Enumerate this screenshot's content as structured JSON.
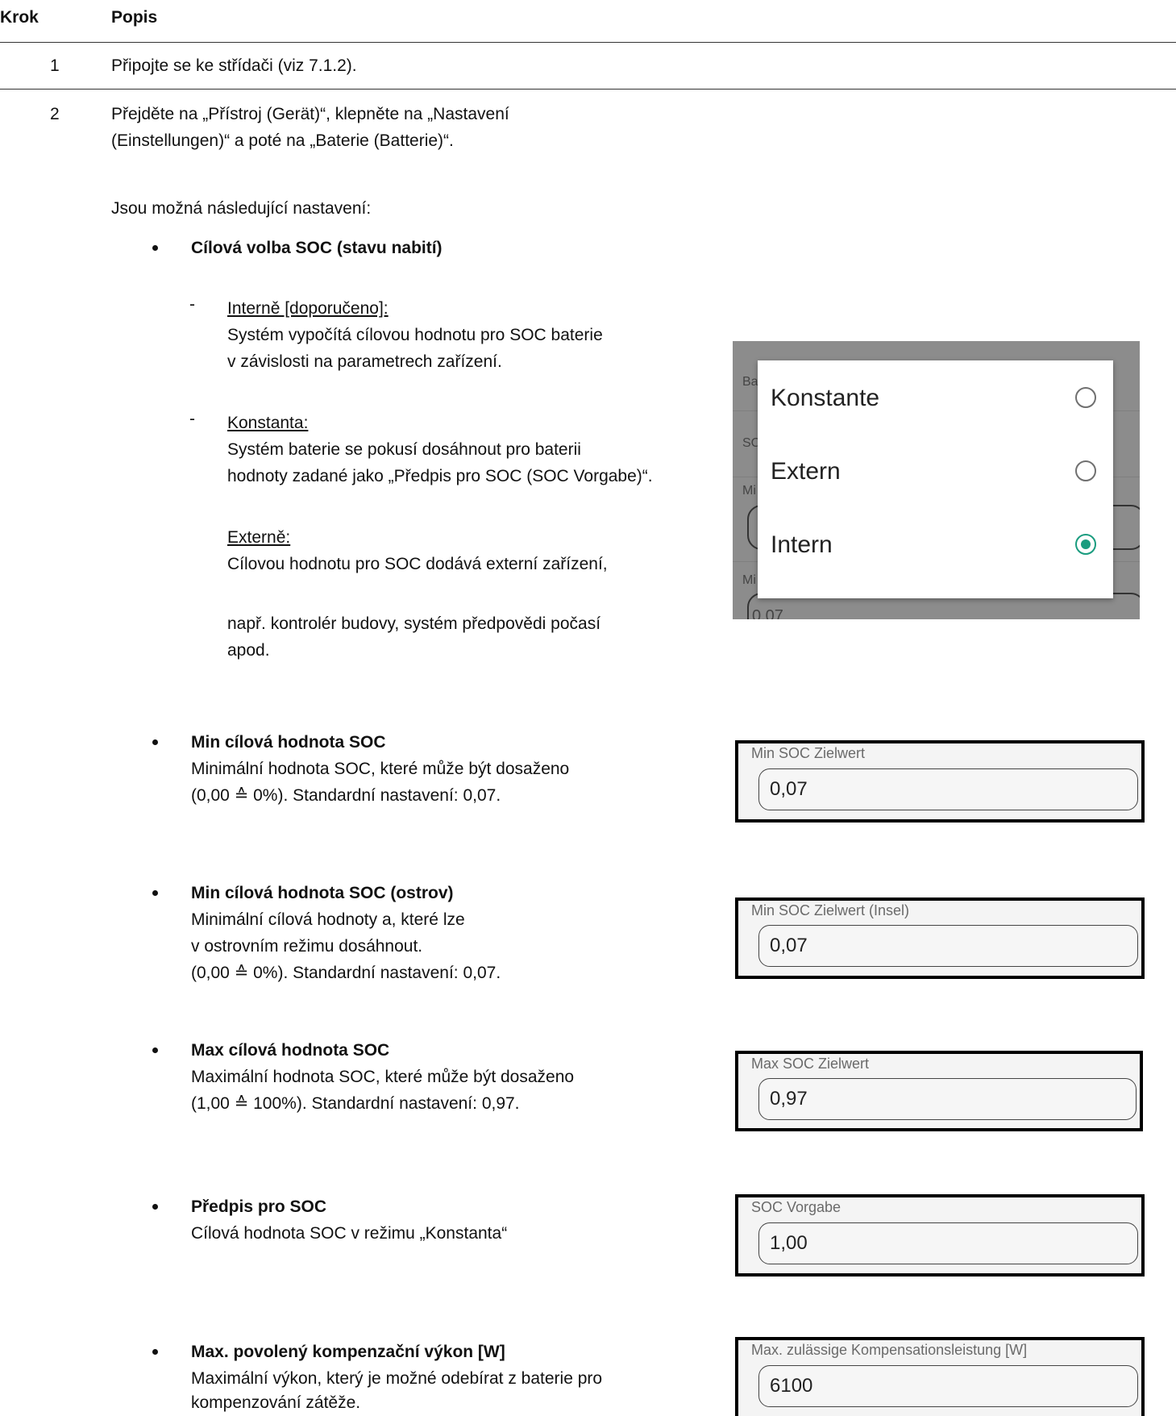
{
  "table": {
    "headers": {
      "step": "Krok",
      "description": "Popis"
    },
    "row1": {
      "step": "1",
      "text": "Připojte se ke střídači (viz 7.1.2)."
    },
    "row2": {
      "step": "2",
      "line1": "Přejděte na „Přístroj (Gerät)“, klepněte na „Nastavení",
      "line2": "(Einstellungen)“ a poté na „Baterie (Batterie)“.",
      "intro": "Jsou možná následující nastavení:"
    }
  },
  "soc_target": {
    "title": "Cílová volba SOC (stavu nabití)",
    "intern": {
      "label": "Interně [doporučeno]:",
      "line1": "Systém vypočítá cílovou hodnotu pro SOC baterie",
      "line2": "v závislosti na parametrech zařízení."
    },
    "konst": {
      "label": "Konstanta:",
      "line1": "Systém baterie se pokusí dosáhnout pro baterii",
      "line2": "hodnoty zadané jako „Předpis pro SOC (SOC Vorgabe)“."
    },
    "extern": {
      "label": "Externě:",
      "line1": "Cílovou hodnotu pro SOC dodává externí zařízení,",
      "line2": "např. kontrolér budovy, systém předpovědi počasí",
      "line3": "apod."
    }
  },
  "dialog": {
    "options": [
      {
        "label": "Konstante",
        "selected": false
      },
      {
        "label": "Extern",
        "selected": false
      },
      {
        "label": "Intern",
        "selected": true
      }
    ],
    "background_fragments": [
      "Ba",
      "SC",
      "Mi",
      "Mi",
      "0,07"
    ],
    "accent_color": "#1a9c7f"
  },
  "min_soc": {
    "title": "Min cílová hodnota SOC",
    "line1": "Minimální hodnota SOC, které může být dosaženo",
    "line2": "(0,00 ≙ 0%). Standardní nastavení: 0,07."
  },
  "min_soc_island": {
    "title": "Min cílová hodnota SOC (ostrov)",
    "line1": "Minimální cílová hodnoty a, které lze",
    "line2": "v ostrovním režimu dosáhnout.",
    "line3": "(0,00 ≙ 0%). Standardní nastavení: 0,07."
  },
  "max_soc": {
    "title": "Max cílová hodnota SOC",
    "line1": "Maximální hodnota SOC, které může být dosaženo",
    "line2": "(1,00 ≙ 100%). Standardní nastavení: 0,97."
  },
  "soc_preset": {
    "title": "Předpis pro SOC",
    "line1": "Cílová hodnota SOC v režimu „Konstanta“"
  },
  "max_comp": {
    "title": "Max. povolený kompenzační výkon [W]",
    "line1": "Maximální výkon, který je možné odebírat z baterie pro",
    "line2": "kompenzování zátěže."
  },
  "fields": {
    "min_soc": {
      "label": "Min SOC Zielwert",
      "value": "0,07"
    },
    "min_soc_island": {
      "label": "Min SOC Zielwert (Insel)",
      "value": "0,07"
    },
    "max_soc": {
      "label": "Max SOC Zielwert",
      "value": "0,97"
    },
    "soc_preset": {
      "label": "SOC Vorgabe",
      "value": "1,00"
    },
    "max_comp": {
      "label": "Max. zulässige Kompensationsleistung [W]",
      "value": "6100"
    }
  }
}
